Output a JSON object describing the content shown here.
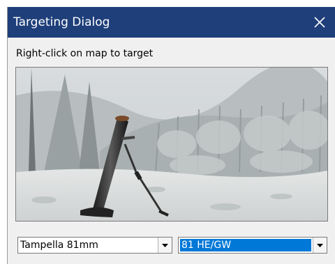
{
  "window": {
    "title": "Targeting Dialog"
  },
  "icons": {
    "close": "close-icon",
    "dropdown": "chevron-down-icon"
  },
  "instruction": "Right-click on map to target",
  "weapon_select": {
    "value": "Tampella 81mm"
  },
  "ammo_select": {
    "value": "81 HE/GW",
    "selected": true
  },
  "colors": {
    "titlebar": "#1f3f7a",
    "selection": "#0078d7",
    "dialog_bg": "#f0f0f0"
  }
}
